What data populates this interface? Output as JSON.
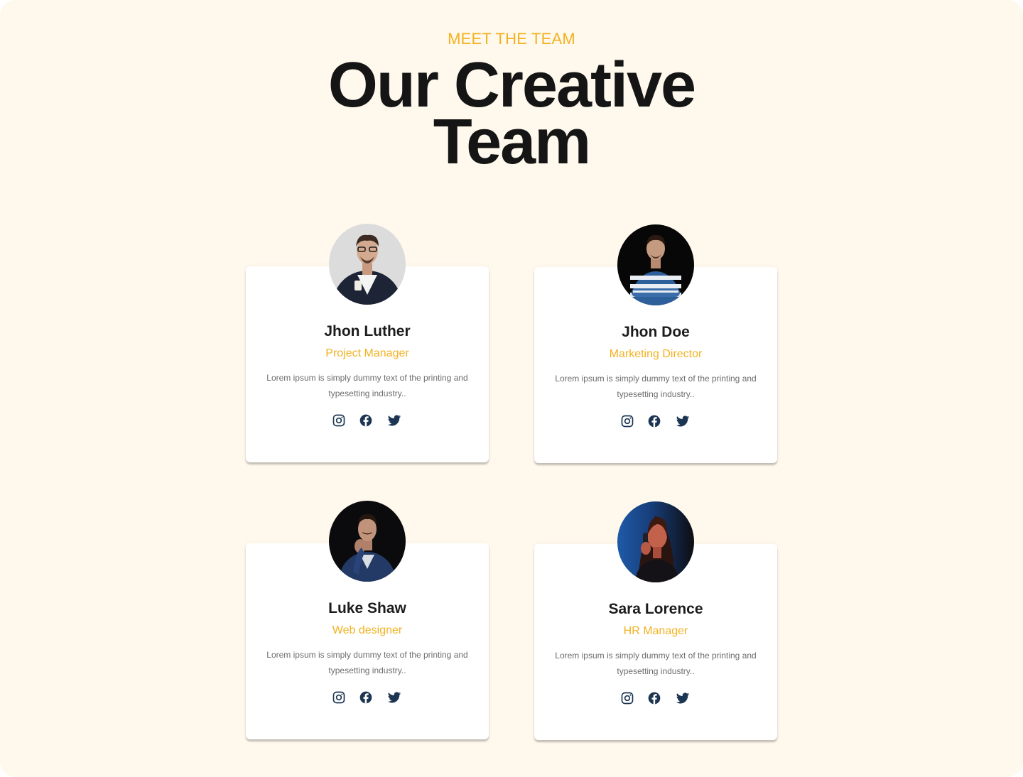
{
  "header": {
    "eyebrow": "MEET THE TEAM",
    "title_line1": "Our Creative",
    "title_line2": "Team"
  },
  "colors": {
    "background": "#fff8ec",
    "accent": "#f2b221",
    "heading": "#151515",
    "icon": "#1c3552"
  },
  "team": [
    {
      "name": "Jhon Luther",
      "role": "Project Manager",
      "description": "Lorem ipsum is simply dummy text of the printing and typesetting industry..",
      "photo": "man-in-navy-suit-holding-coffee-light-background",
      "socials": [
        "instagram-icon",
        "facebook-icon",
        "twitter-icon"
      ]
    },
    {
      "name": "Jhon Doe",
      "role": "Marketing Director",
      "description": "Lorem ipsum is simply dummy text of the printing and typesetting industry..",
      "photo": "man-in-striped-sweater-arms-crossed-dark-background",
      "socials": [
        "instagram-icon",
        "facebook-icon",
        "twitter-icon"
      ]
    },
    {
      "name": "Luke Shaw",
      "role": "Web designer",
      "description": "Lorem ipsum is simply dummy text of the printing and typesetting industry..",
      "photo": "man-in-blue-suit-hand-on-chin-dark-background",
      "socials": [
        "instagram-icon",
        "facebook-icon",
        "twitter-icon"
      ]
    },
    {
      "name": "Sara Lorence",
      "role": "HR Manager",
      "description": "Lorem ipsum is simply dummy text of the printing and typesetting industry..",
      "photo": "woman-on-phone-blue-and-red-light",
      "socials": [
        "instagram-icon",
        "facebook-icon",
        "twitter-icon"
      ]
    }
  ]
}
